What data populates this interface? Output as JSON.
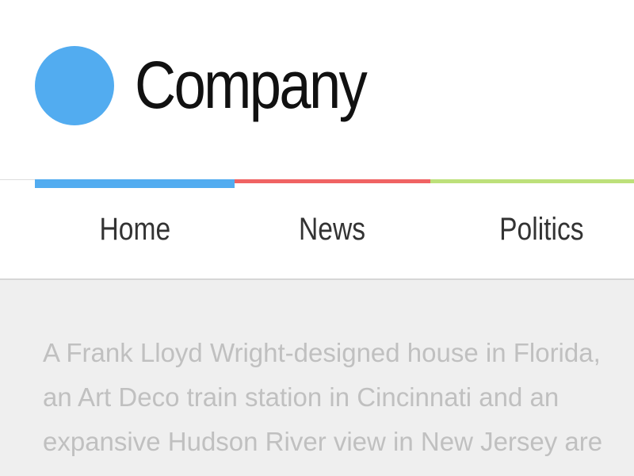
{
  "header": {
    "brand_name": "Company",
    "logo_color": "#52acf0"
  },
  "nav": {
    "items": [
      {
        "label": "Home",
        "color": "#52acf0",
        "active": true
      },
      {
        "label": "News",
        "color": "#f06363"
      },
      {
        "label": "Politics",
        "color": "#bde07a"
      }
    ]
  },
  "content": {
    "lines": [
      "A Frank Lloyd Wright-designed house in Florida,",
      "an Art Deco train station in Cincinnati and an",
      "expansive Hudson River view in New Jersey are"
    ]
  }
}
